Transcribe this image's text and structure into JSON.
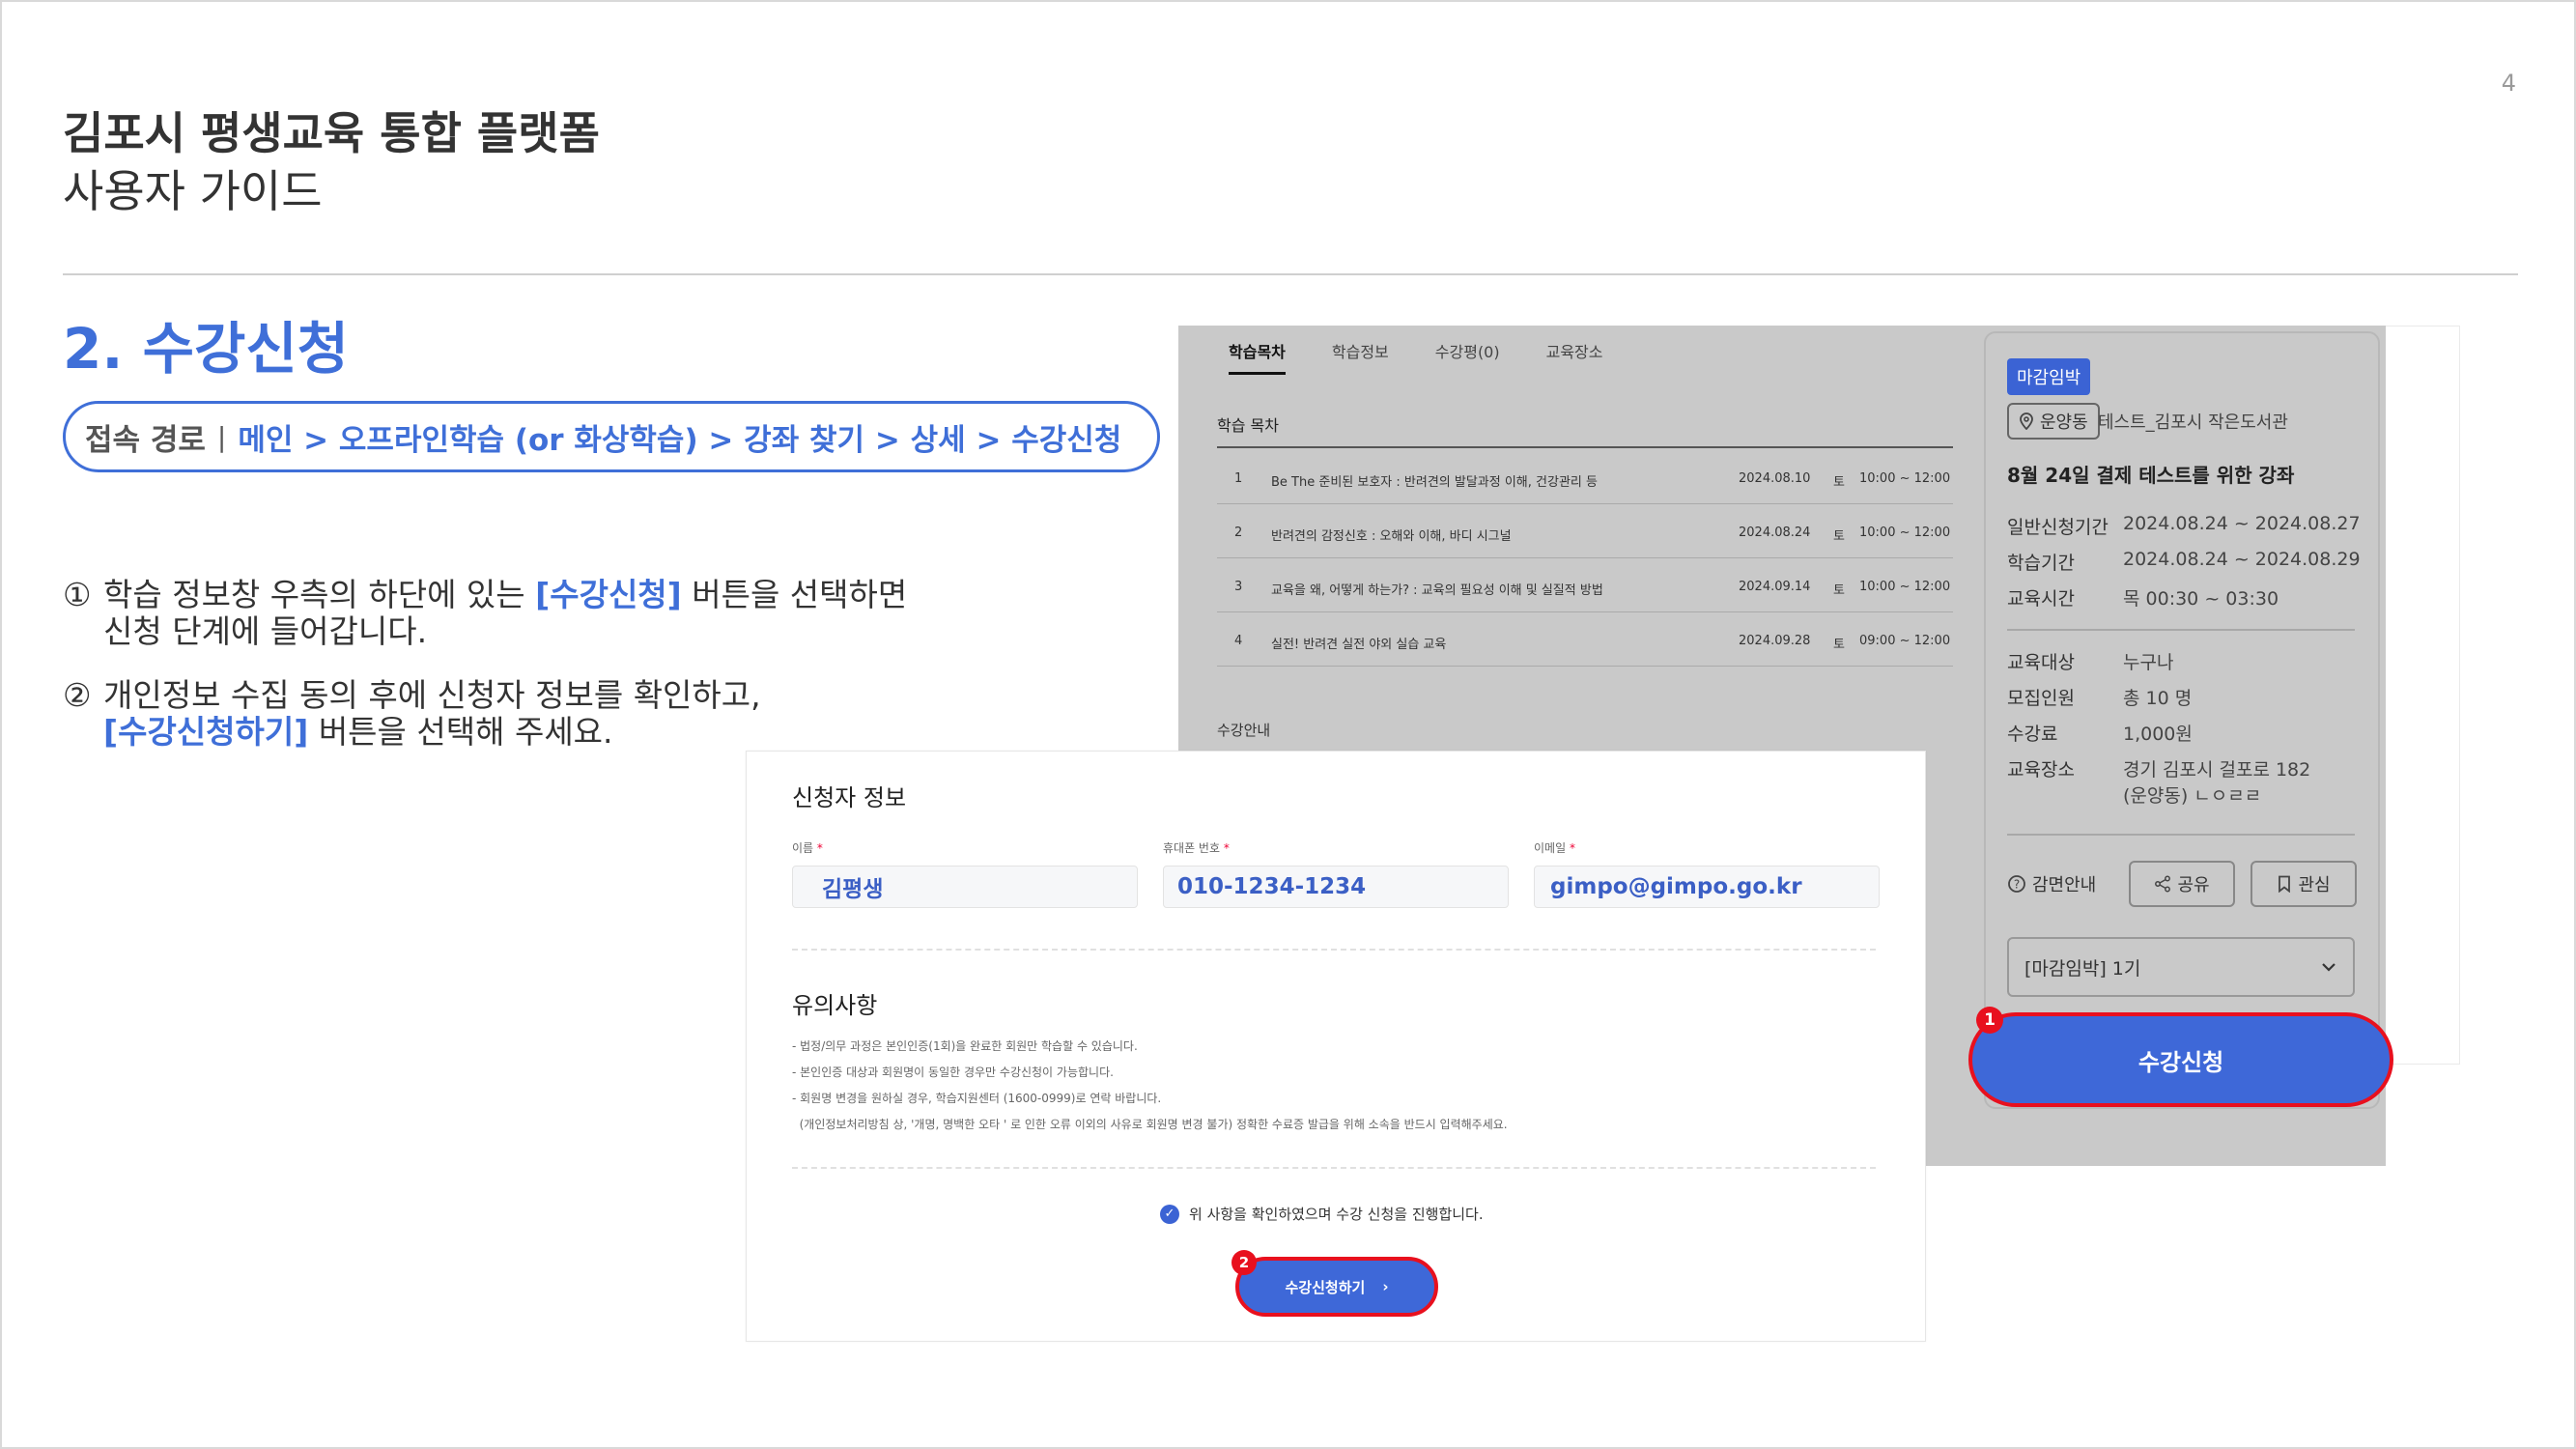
{
  "page": {
    "number": "4",
    "title": "김포시 평생교육 통합 플랫폼",
    "subtitle": "사용자 가이드",
    "section_title": "2. 수강신청"
  },
  "path": {
    "label": "접속 경로",
    "separator": "|",
    "route": "메인 > 오프라인학습 (or 화상학습) > 강좌 찾기 > 상세 > 수강신청"
  },
  "steps": [
    {
      "num": "①",
      "before": "학습 정보창 우측의 하단에 있는 ",
      "highlight": "[수강신청]",
      "after": " 버튼을 선택하면",
      "line2": "신청 단계에 들어갑니다."
    },
    {
      "num": "②",
      "line1": "개인정보 수집 동의 후에 신청자 정보를 확인하고,",
      "highlight": "[수강신청하기]",
      "after": " 버튼을 선택해 주세요."
    }
  ],
  "detail": {
    "tabs": [
      "학습목차",
      "학습정보",
      "수강평(0)",
      "교육장소"
    ],
    "curriculum_heading": "학습 목차",
    "curriculum": [
      {
        "no": "1",
        "title": "Be The 준비된 보호자 : 반려견의 발달과정 이해, 건강관리 등",
        "date": "2024.08.10",
        "day": "토",
        "time": "10:00 ~ 12:00"
      },
      {
        "no": "2",
        "title": "반려견의 감정신호 : 오해와 이해, 바디 시그널",
        "date": "2024.08.24",
        "day": "토",
        "time": "10:00 ~ 12:00"
      },
      {
        "no": "3",
        "title": "교육을 왜, 어떻게 하는가? : 교육의 필요성 이해 및 실질적 방법",
        "date": "2024.09.14",
        "day": "토",
        "time": "10:00 ~ 12:00"
      },
      {
        "no": "4",
        "title": "실전! 반려견 실전 야외 실습 교육",
        "date": "2024.09.28",
        "day": "토",
        "time": "09:00 ~ 12:00"
      }
    ],
    "guide_heading": "수강안내",
    "card": {
      "badge": "마감임박",
      "location_chip": "운양동",
      "location_name": "테스트_김포시 작은도서관",
      "course_title": "8월 24일 결제 테스트를 위한 강좌",
      "schedule": [
        {
          "k": "일반신청기간",
          "v": "2024.08.24 ~ 2024.08.27"
        },
        {
          "k": "학습기간",
          "v": "2024.08.24 ~ 2024.08.29"
        },
        {
          "k": "교육시간",
          "v": "목 00:30 ~ 03:30"
        }
      ],
      "info": [
        {
          "k": "교육대상",
          "v": "누구나"
        },
        {
          "k": "모집인원",
          "v": "총 10 명"
        },
        {
          "k": "수강료",
          "v": "1,000원"
        },
        {
          "k": "교육장소",
          "v": "경기 김포시 걸포로 182"
        }
      ],
      "address_line2": "(운양동) ㄴㅇㄹㄹ",
      "reduction_label": "감면안내",
      "share_label": "공유",
      "like_label": "관심",
      "select_value": "[마감임박] 1기",
      "apply_label": "수강신청",
      "marker": "1"
    }
  },
  "form": {
    "title": "신청자 정보",
    "fields": [
      {
        "label": "이름",
        "value": "김평생"
      },
      {
        "label": "휴대폰 번호",
        "value": "010-1234-1234"
      },
      {
        "label": "이메일",
        "value": "gimpo@gimpo.go.kr"
      }
    ],
    "required_mark": "*",
    "notice_heading": "유의사항",
    "notices": [
      "- 법정/의무 과정은 본인인증(1회)을 완료한 회원만 학습할 수 있습니다.",
      "- 본인인증 대상과 회원명이 동일한 경우만 수강신청이 가능합니다.",
      "- 회원명 변경을 원하실 경우, 학습지원센터 (1600-0999)로 연락 바랍니다.",
      "  (개인정보처리방침 상, '개명, 명백한 오타 ' 로 인한 오류 이외의 사유로 회원명 변경 불가) 정확한 수료증 발급을 위해 소속을 반드시 입력해주세요."
    ],
    "agree_text": "위 사항을 확인하였으며 수강 신청을 진행합니다.",
    "submit_label": "수강신청하기",
    "marker": "2"
  },
  "colors": {
    "accent": "#3f6fd8",
    "highlight_border": "#e8101e",
    "overlay_gray": "#c9c9c9"
  }
}
